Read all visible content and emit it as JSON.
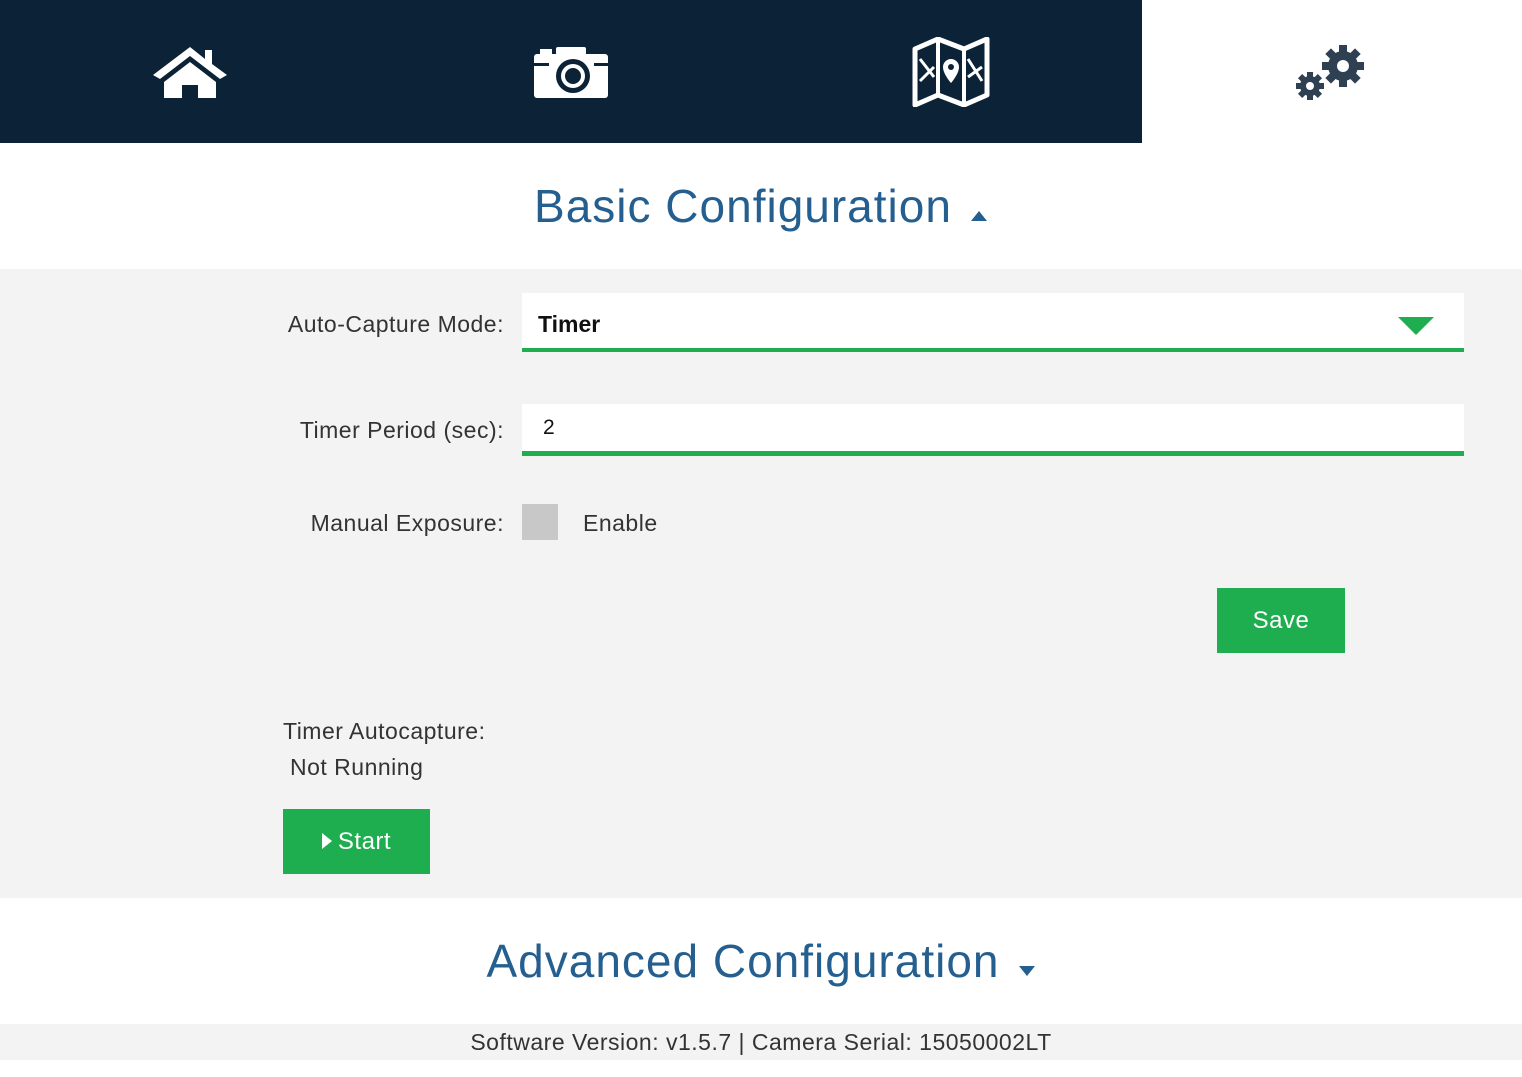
{
  "nav": {
    "tabs": [
      {
        "icon": "home-icon"
      },
      {
        "icon": "camera-icon"
      },
      {
        "icon": "map-icon"
      },
      {
        "icon": "gears-icon",
        "active": true
      }
    ]
  },
  "basic": {
    "title": "Basic Configuration",
    "auto_capture_label": "Auto-Capture Mode:",
    "auto_capture_value": "Timer",
    "timer_period_label": "Timer Period (sec):",
    "timer_period_value": "2",
    "manual_exposure_label": "Manual Exposure:",
    "enable_label": "Enable",
    "save_label": "Save",
    "status_title": "Timer Autocapture:",
    "status_value": "Not Running",
    "start_label": "Start"
  },
  "advanced": {
    "title": "Advanced Configuration"
  },
  "footer": {
    "text": "Software Version: v1.5.7 | Camera Serial: 15050002LT"
  },
  "colors": {
    "nav_bg": "#0c2236",
    "accent_green": "#1fae4f",
    "heading_blue": "#245f8f",
    "panel_bg": "#f3f3f3"
  }
}
